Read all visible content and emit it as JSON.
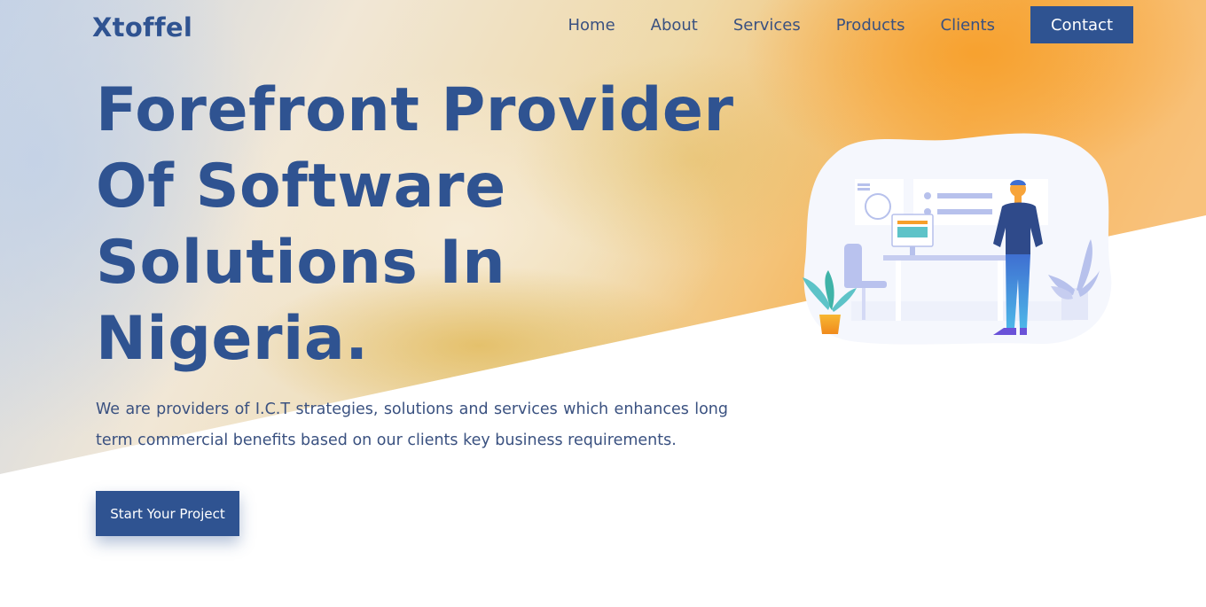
{
  "brand": {
    "name": "Xtoffel"
  },
  "nav": {
    "links": [
      "Home",
      "About",
      "Services",
      "Products",
      "Clients"
    ],
    "contact_label": "Contact"
  },
  "hero": {
    "headline_lines": [
      "Forefront Provider",
      "Of Software",
      "Solutions In",
      "Nigeria."
    ],
    "description": "We are providers of I.C.T strategies, solutions and services which enhances long term commercial benefits based on our clients key business requirements.",
    "cta_label": "Start Your Project"
  },
  "colors": {
    "brand_blue": "#2f5391",
    "text_blue": "#3a5180",
    "accent_orange": "#f7a43a",
    "accent_gold": "#e6c472",
    "accent_lightblue": "#c6d3e6"
  },
  "illustration": {
    "icon": "office-worker-illustration"
  }
}
